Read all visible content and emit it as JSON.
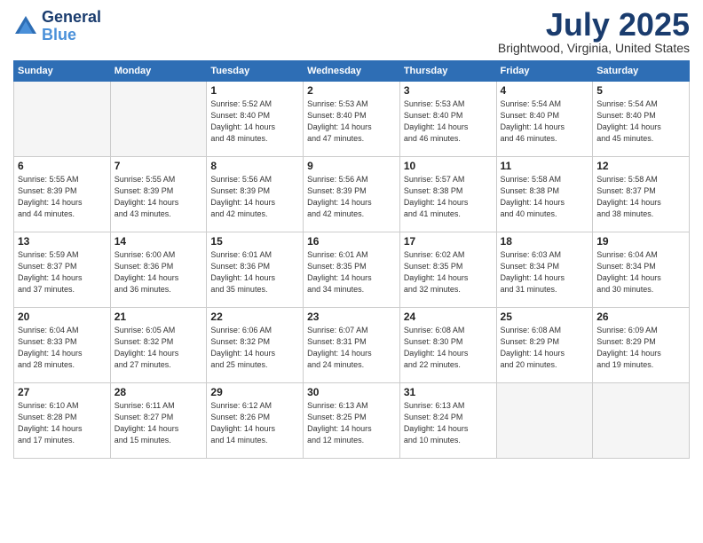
{
  "header": {
    "logo_general": "General",
    "logo_blue": "Blue",
    "month_title": "July 2025",
    "location": "Brightwood, Virginia, United States"
  },
  "days_of_week": [
    "Sunday",
    "Monday",
    "Tuesday",
    "Wednesday",
    "Thursday",
    "Friday",
    "Saturday"
  ],
  "weeks": [
    [
      {
        "day": "",
        "info": ""
      },
      {
        "day": "",
        "info": ""
      },
      {
        "day": "1",
        "info": "Sunrise: 5:52 AM\nSunset: 8:40 PM\nDaylight: 14 hours\nand 48 minutes."
      },
      {
        "day": "2",
        "info": "Sunrise: 5:53 AM\nSunset: 8:40 PM\nDaylight: 14 hours\nand 47 minutes."
      },
      {
        "day": "3",
        "info": "Sunrise: 5:53 AM\nSunset: 8:40 PM\nDaylight: 14 hours\nand 46 minutes."
      },
      {
        "day": "4",
        "info": "Sunrise: 5:54 AM\nSunset: 8:40 PM\nDaylight: 14 hours\nand 46 minutes."
      },
      {
        "day": "5",
        "info": "Sunrise: 5:54 AM\nSunset: 8:40 PM\nDaylight: 14 hours\nand 45 minutes."
      }
    ],
    [
      {
        "day": "6",
        "info": "Sunrise: 5:55 AM\nSunset: 8:39 PM\nDaylight: 14 hours\nand 44 minutes."
      },
      {
        "day": "7",
        "info": "Sunrise: 5:55 AM\nSunset: 8:39 PM\nDaylight: 14 hours\nand 43 minutes."
      },
      {
        "day": "8",
        "info": "Sunrise: 5:56 AM\nSunset: 8:39 PM\nDaylight: 14 hours\nand 42 minutes."
      },
      {
        "day": "9",
        "info": "Sunrise: 5:56 AM\nSunset: 8:39 PM\nDaylight: 14 hours\nand 42 minutes."
      },
      {
        "day": "10",
        "info": "Sunrise: 5:57 AM\nSunset: 8:38 PM\nDaylight: 14 hours\nand 41 minutes."
      },
      {
        "day": "11",
        "info": "Sunrise: 5:58 AM\nSunset: 8:38 PM\nDaylight: 14 hours\nand 40 minutes."
      },
      {
        "day": "12",
        "info": "Sunrise: 5:58 AM\nSunset: 8:37 PM\nDaylight: 14 hours\nand 38 minutes."
      }
    ],
    [
      {
        "day": "13",
        "info": "Sunrise: 5:59 AM\nSunset: 8:37 PM\nDaylight: 14 hours\nand 37 minutes."
      },
      {
        "day": "14",
        "info": "Sunrise: 6:00 AM\nSunset: 8:36 PM\nDaylight: 14 hours\nand 36 minutes."
      },
      {
        "day": "15",
        "info": "Sunrise: 6:01 AM\nSunset: 8:36 PM\nDaylight: 14 hours\nand 35 minutes."
      },
      {
        "day": "16",
        "info": "Sunrise: 6:01 AM\nSunset: 8:35 PM\nDaylight: 14 hours\nand 34 minutes."
      },
      {
        "day": "17",
        "info": "Sunrise: 6:02 AM\nSunset: 8:35 PM\nDaylight: 14 hours\nand 32 minutes."
      },
      {
        "day": "18",
        "info": "Sunrise: 6:03 AM\nSunset: 8:34 PM\nDaylight: 14 hours\nand 31 minutes."
      },
      {
        "day": "19",
        "info": "Sunrise: 6:04 AM\nSunset: 8:34 PM\nDaylight: 14 hours\nand 30 minutes."
      }
    ],
    [
      {
        "day": "20",
        "info": "Sunrise: 6:04 AM\nSunset: 8:33 PM\nDaylight: 14 hours\nand 28 minutes."
      },
      {
        "day": "21",
        "info": "Sunrise: 6:05 AM\nSunset: 8:32 PM\nDaylight: 14 hours\nand 27 minutes."
      },
      {
        "day": "22",
        "info": "Sunrise: 6:06 AM\nSunset: 8:32 PM\nDaylight: 14 hours\nand 25 minutes."
      },
      {
        "day": "23",
        "info": "Sunrise: 6:07 AM\nSunset: 8:31 PM\nDaylight: 14 hours\nand 24 minutes."
      },
      {
        "day": "24",
        "info": "Sunrise: 6:08 AM\nSunset: 8:30 PM\nDaylight: 14 hours\nand 22 minutes."
      },
      {
        "day": "25",
        "info": "Sunrise: 6:08 AM\nSunset: 8:29 PM\nDaylight: 14 hours\nand 20 minutes."
      },
      {
        "day": "26",
        "info": "Sunrise: 6:09 AM\nSunset: 8:29 PM\nDaylight: 14 hours\nand 19 minutes."
      }
    ],
    [
      {
        "day": "27",
        "info": "Sunrise: 6:10 AM\nSunset: 8:28 PM\nDaylight: 14 hours\nand 17 minutes."
      },
      {
        "day": "28",
        "info": "Sunrise: 6:11 AM\nSunset: 8:27 PM\nDaylight: 14 hours\nand 15 minutes."
      },
      {
        "day": "29",
        "info": "Sunrise: 6:12 AM\nSunset: 8:26 PM\nDaylight: 14 hours\nand 14 minutes."
      },
      {
        "day": "30",
        "info": "Sunrise: 6:13 AM\nSunset: 8:25 PM\nDaylight: 14 hours\nand 12 minutes."
      },
      {
        "day": "31",
        "info": "Sunrise: 6:13 AM\nSunset: 8:24 PM\nDaylight: 14 hours\nand 10 minutes."
      },
      {
        "day": "",
        "info": ""
      },
      {
        "day": "",
        "info": ""
      }
    ]
  ]
}
